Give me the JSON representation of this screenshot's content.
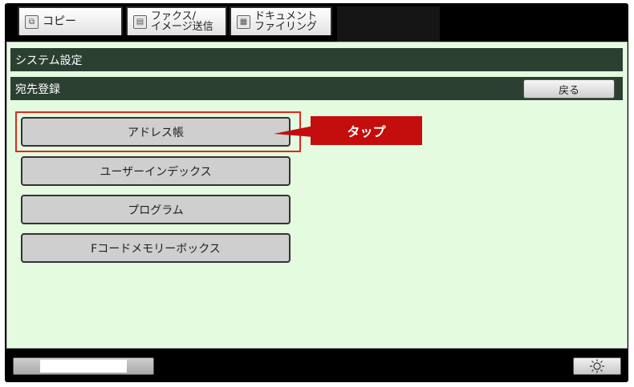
{
  "tabs": [
    {
      "icon": "copy-icon",
      "label": "コピー"
    },
    {
      "icon": "fax-icon",
      "line1": "ファクス/",
      "line2": "イメージ送信"
    },
    {
      "icon": "document-icon",
      "line1": "ドキュメント",
      "line2": "ファイリング"
    }
  ],
  "header": {
    "title": "システム設定",
    "subtitle": "宛先登録",
    "back_label": "戻る"
  },
  "menu": [
    {
      "label": "アドレス帳"
    },
    {
      "label": "ユーザーインデックス"
    },
    {
      "label": "プログラム"
    },
    {
      "label": "Fコードメモリーボックス"
    }
  ],
  "annotation": {
    "label": "タップ",
    "color": "#c40d0d",
    "highlight_color": "#e0281d"
  },
  "footer": {
    "brightness_icon": "sun-icon"
  }
}
